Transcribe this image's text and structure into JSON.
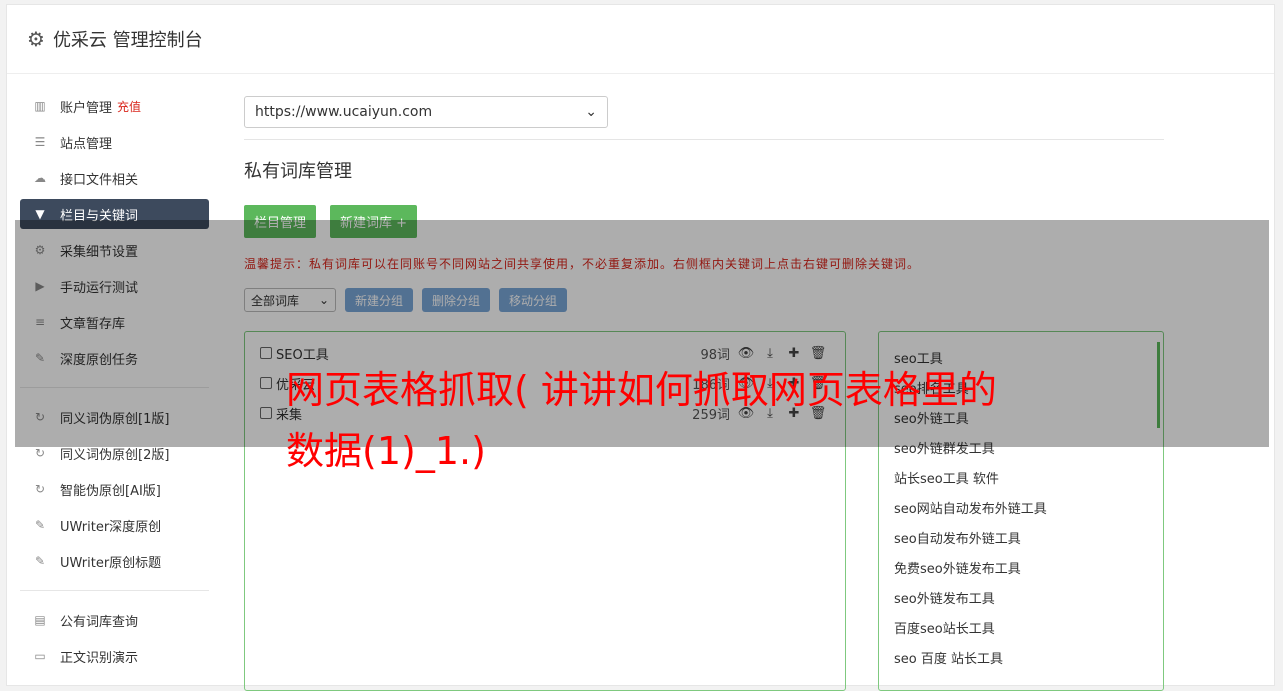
{
  "header": {
    "icon": "gear-icon",
    "title": "优采云 管理控制台"
  },
  "sidebar": {
    "group1": [
      {
        "icon": "bar-chart-icon",
        "label": "账户管理",
        "badge": "充值"
      },
      {
        "icon": "server-icon",
        "label": "站点管理"
      },
      {
        "icon": "cloud-upload-icon",
        "label": "接口文件相关"
      },
      {
        "icon": "filter-icon",
        "label": "栏目与关键词",
        "active": true
      },
      {
        "icon": "gears-icon",
        "label": "采集细节设置"
      },
      {
        "icon": "play-circle-icon",
        "label": "手动运行测试"
      },
      {
        "icon": "database-icon",
        "label": "文章暂存库"
      },
      {
        "icon": "edit-icon",
        "label": "深度原创任务"
      }
    ],
    "group2": [
      {
        "icon": "refresh-icon",
        "label": "同义词伪原创[1版]"
      },
      {
        "icon": "refresh-icon",
        "label": "同义词伪原创[2版]"
      },
      {
        "icon": "refresh-icon",
        "label": "智能伪原创[AI版]"
      },
      {
        "icon": "edit-icon",
        "label": "UWriter深度原创"
      },
      {
        "icon": "edit-icon",
        "label": "UWriter原创标题"
      }
    ],
    "group3": [
      {
        "icon": "book-icon",
        "label": "公有词库查询"
      },
      {
        "icon": "desktop-icon",
        "label": "正文识别演示"
      }
    ]
  },
  "main": {
    "site_select": "https://www.ucaiyun.com",
    "section_title": "私有词库管理",
    "buttons": {
      "column_manage": "栏目管理",
      "new_library": "新建词库 +"
    },
    "tip": "温馨提示：私有词库可以在同账号不同网站之间共享使用，不必重复添加。右侧框内关键词上点击右键可删除关键词。",
    "library_filter": "全部词库",
    "group_buttons": {
      "new_group": "新建分组",
      "delete_group": "删除分组",
      "move_group": "移动分组"
    },
    "libraries": [
      {
        "name": "SEO工具",
        "count": "98词"
      },
      {
        "name": "优采云",
        "count": "186词"
      },
      {
        "name": "采集",
        "count": "259词"
      }
    ],
    "keywords": [
      "seo工具",
      "seo排名工具",
      "seo外链工具",
      "seo外链群发工具",
      "站长seo工具 软件",
      "seo网站自动发布外链工具",
      "seo自动发布外链工具",
      "免费seo外链发布工具",
      "seo外链发布工具",
      "百度seo站长工具",
      "seo 百度 站长工具"
    ]
  },
  "overlay_headline": "网页表格抓取( 讲讲如何抓取网页表格里的数据(1)_1.)",
  "colors": {
    "sidebar_active": "#3d4a5d",
    "green": "#5cb85c",
    "blue_button": "#7aa7d8",
    "tip_red": "#d9261c",
    "headline_red": "#ff0000"
  }
}
